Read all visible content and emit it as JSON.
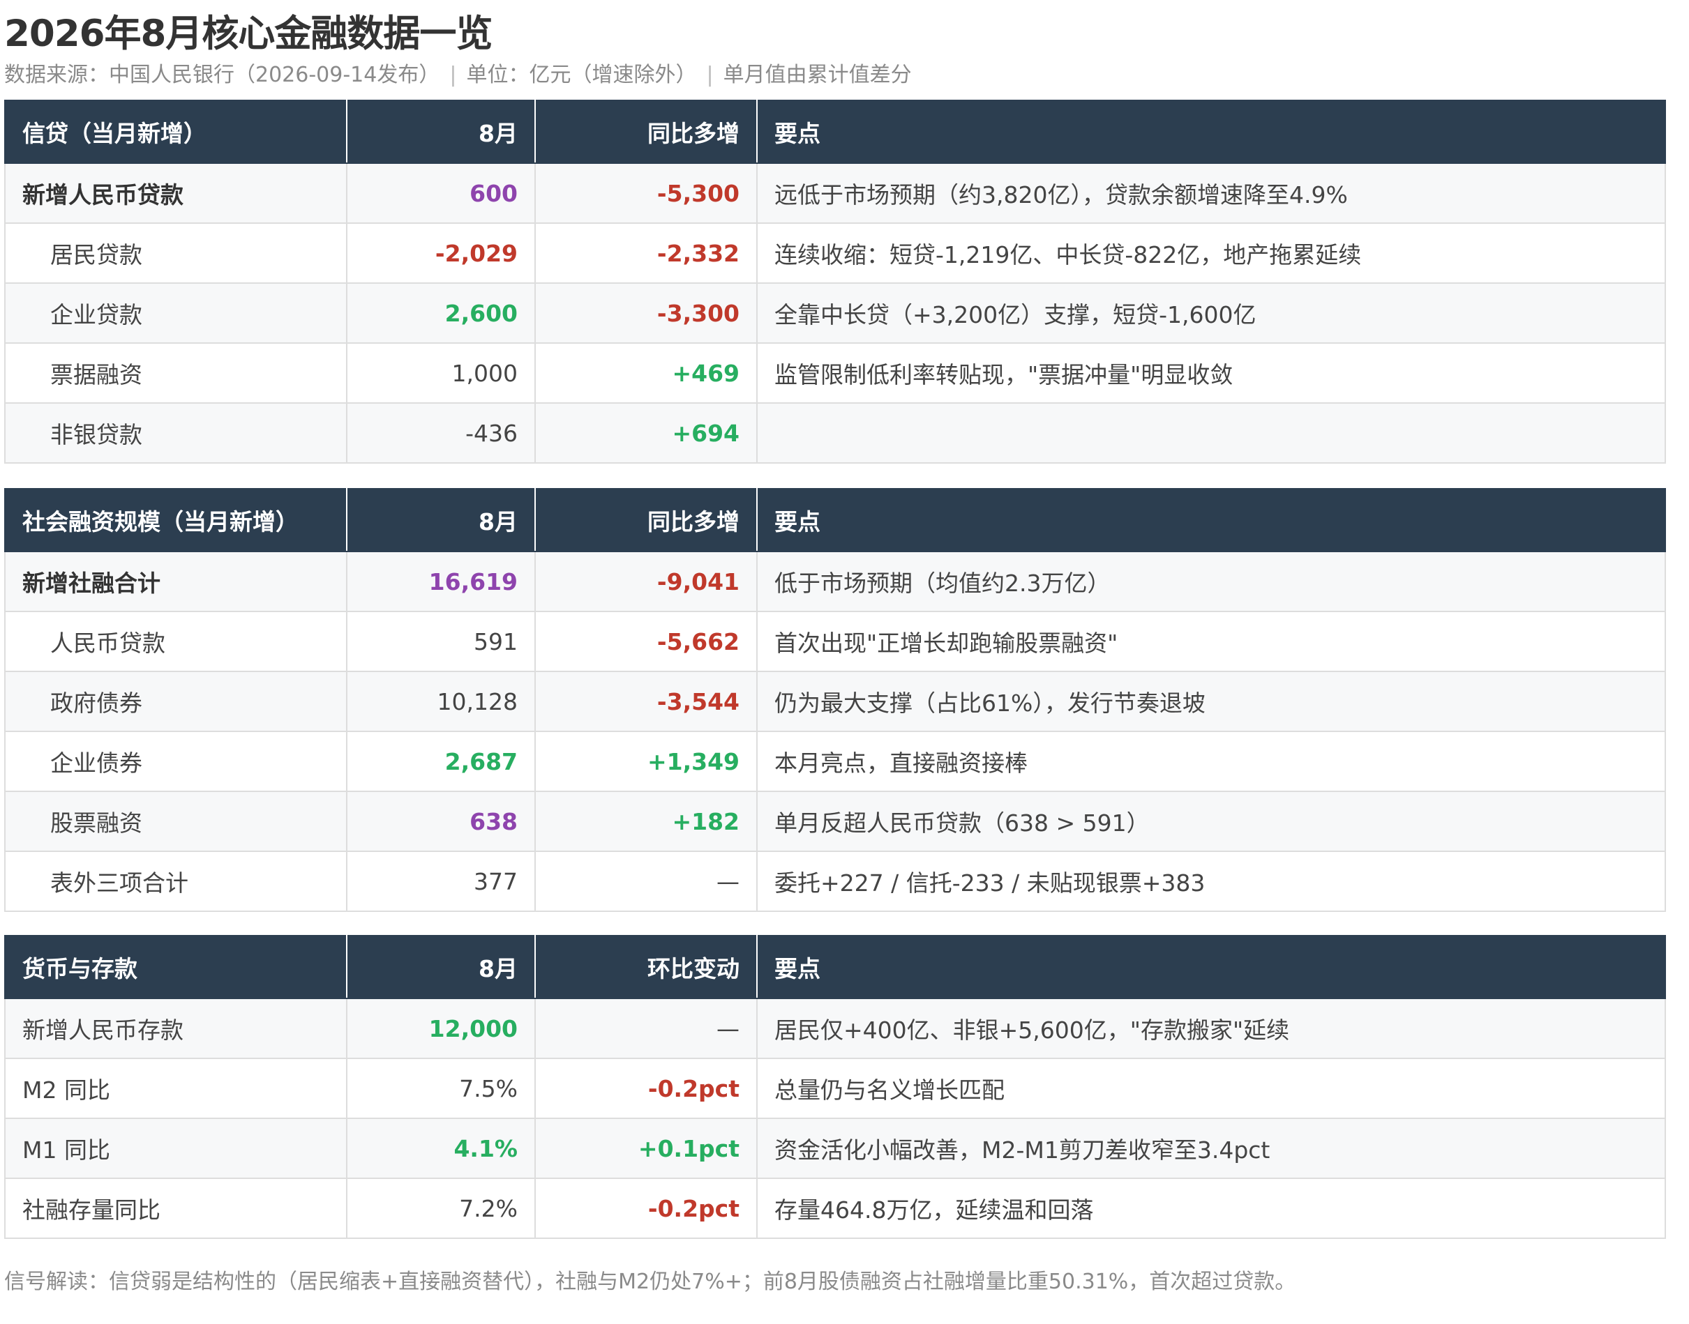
{
  "title": "2026年8月核心金融数据一览",
  "subtitle": {
    "source": "数据来源：中国人民银行（2026-09-14发布）",
    "unit": "单位：亿元（增速除外）",
    "note": "单月值由累计值差分",
    "separator": "|"
  },
  "tables": [
    {
      "headers": [
        "信贷（当月新增）",
        "8月",
        "同比多增",
        "要点"
      ],
      "rows": [
        {
          "label": "新增人民币贷款",
          "value": "600",
          "change": "-5,300",
          "note": "远低于市场预期（约3,820亿），贷款余额增速降至4.9%"
        },
        {
          "label": "居民贷款",
          "value": "-2,029",
          "change": "-2,332",
          "note": "连续收缩：短贷-1,219亿、中长贷-822亿，地产拖累延续"
        },
        {
          "label": "企业贷款",
          "value": "2,600",
          "change": "-3,300",
          "note": "全靠中长贷（+3,200亿）支撑，短贷-1,600亿"
        },
        {
          "label": "票据融资",
          "value": "1,000",
          "change": "+469",
          "note": "监管限制低利率转贴现，\"票据冲量\"明显收敛"
        },
        {
          "label": "非银贷款",
          "value": "-436",
          "change": "+694",
          "note": ""
        }
      ]
    },
    {
      "headers": [
        "社会融资规模（当月新增）",
        "8月",
        "同比多增",
        "要点"
      ],
      "rows": [
        {
          "label": "新增社融合计",
          "value": "16,619",
          "change": "-9,041",
          "note": "低于市场预期（均值约2.3万亿）"
        },
        {
          "label": "人民币贷款",
          "value": "591",
          "change": "-5,662",
          "note": "首次出现\"正增长却跑输股票融资\""
        },
        {
          "label": "政府债券",
          "value": "10,128",
          "change": "-3,544",
          "note": "仍为最大支撑（占比61%），发行节奏退坡"
        },
        {
          "label": "企业债券",
          "value": "2,687",
          "change": "+1,349",
          "note": "本月亮点，直接融资接棒"
        },
        {
          "label": "股票融资",
          "value": "638",
          "change": "+182",
          "note": "单月反超人民币贷款（638 > 591）"
        },
        {
          "label": "表外三项合计",
          "value": "377",
          "change": "—",
          "note": "委托+227 / 信托-233 / 未贴现银票+383"
        }
      ]
    },
    {
      "headers": [
        "货币与存款",
        "8月",
        "环比变动",
        "要点"
      ],
      "rows": [
        {
          "label": "新增人民币存款",
          "value": "12,000",
          "change": "—",
          "note": "居民仅+400亿、非银+5,600亿，\"存款搬家\"延续"
        },
        {
          "label": "M2 同比",
          "value": "7.5%",
          "change": "-0.2pct",
          "note": "总量仍与名义增长匹配"
        },
        {
          "label": "M1 同比",
          "value": "4.1%",
          "change": "+0.1pct",
          "note": "资金活化小幅改善，M2-M1剪刀差收窄至3.4pct"
        },
        {
          "label": "社融存量同比",
          "value": "7.2%",
          "change": "-0.2pct",
          "note": "存量464.8万亿，延续温和回落"
        }
      ]
    }
  ],
  "footnote": "信号解读：信贷弱是结构性的（居民缩表+直接融资替代），社融与M2仍处7%+；前8月股债融资占社融增量比重50.31%，首次超过贷款。",
  "colors": {
    "header_bg": "#2c3e50",
    "negative": "#c0392b",
    "positive": "#27ae60",
    "highlight": "#8e44ad"
  }
}
